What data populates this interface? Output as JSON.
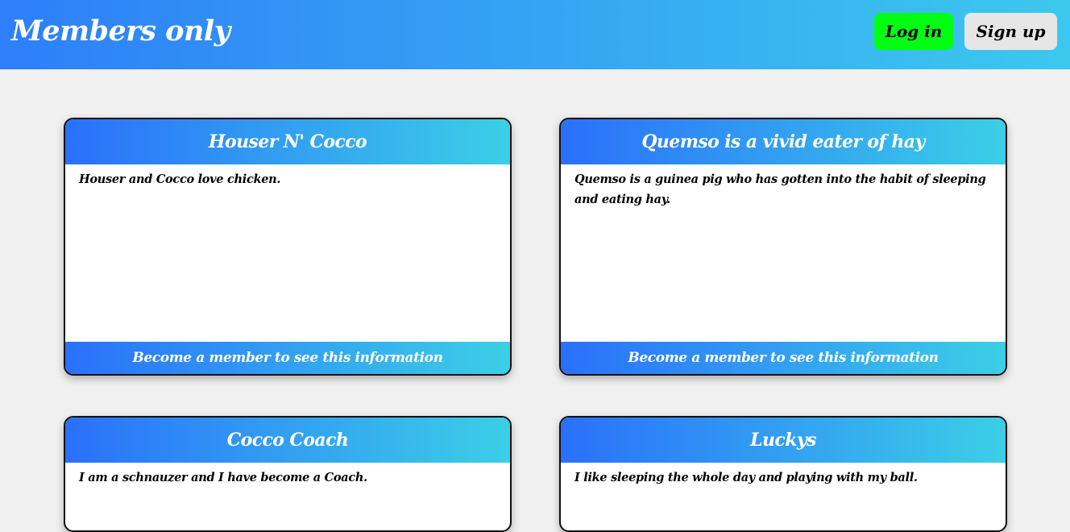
{
  "header": {
    "title": "Members only",
    "login_label": "Log in",
    "signup_label": "Sign up"
  },
  "colors": {
    "header_gradient_start": "#2e7ff8",
    "header_gradient_end": "#3cc8ee",
    "login_button": "#00ff12",
    "signup_button": "#e6e6e6",
    "page_background": "#f0f0f0"
  },
  "posts": [
    {
      "title": "Houser N' Cocco",
      "body": "Houser and Cocco love chicken.",
      "footer": "Become a member to see this information"
    },
    {
      "title": "Quemso is a vivid eater of hay",
      "body": "Quemso is a guinea pig who has gotten into the habit of sleeping and eating hay.",
      "footer": "Become a member to see this information"
    },
    {
      "title": "Cocco Coach",
      "body": "I am a schnauzer and I have become a Coach.",
      "footer": ""
    },
    {
      "title": "Luckys",
      "body": "I like sleeping the whole day and playing with my ball.",
      "footer": ""
    }
  ]
}
